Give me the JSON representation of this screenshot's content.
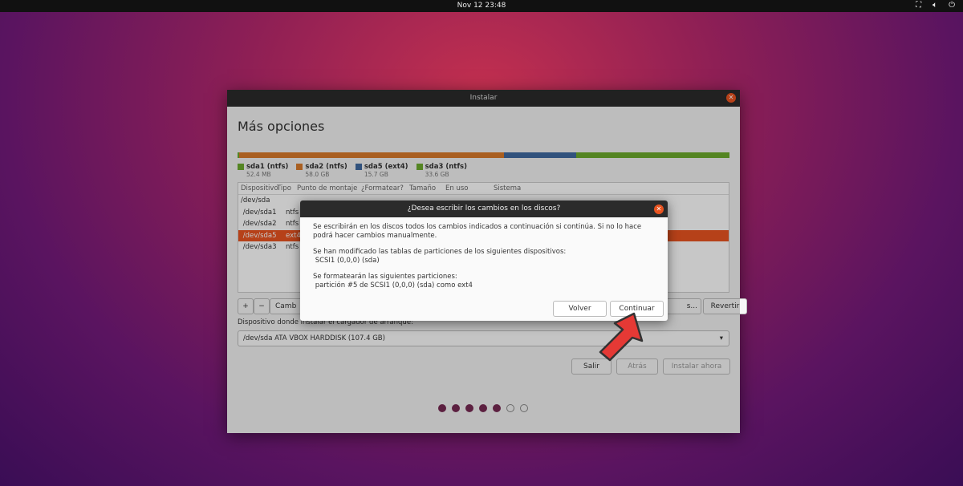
{
  "topbar": {
    "clock": "Nov 12  23:48",
    "icons": [
      "network-icon",
      "volume-icon",
      "power-icon"
    ]
  },
  "window": {
    "title": "Instalar",
    "heading": "Más opciones",
    "partitions": [
      {
        "name": "sda1 (ntfs)",
        "size": "52.4 MB",
        "color": "#6cab2e",
        "gb": 0.05
      },
      {
        "name": "sda2 (ntfs)",
        "size": "58.0 GB",
        "color": "#d97a2b",
        "gb": 58.0
      },
      {
        "name": "sda5 (ext4)",
        "size": "15.7 GB",
        "color": "#3f69a0",
        "gb": 15.7
      },
      {
        "name": "sda3 (ntfs)",
        "size": "33.6 GB",
        "color": "#6cab2e",
        "gb": 33.6
      }
    ],
    "table_headers": [
      "Dispositivo",
      "Tipo",
      "Punto de montaje",
      "¿Formatear?",
      "Tamaño",
      "En uso",
      "Sistema"
    ],
    "rows": [
      {
        "device": "/dev/sda",
        "type": ""
      },
      {
        "device": " /dev/sda1",
        "type": "ntfs"
      },
      {
        "device": " /dev/sda2",
        "type": "ntfs"
      },
      {
        "device": " /dev/sda5",
        "type": "ext4",
        "selected": true
      },
      {
        "device": " /dev/sda3",
        "type": "ntfs"
      }
    ],
    "tools": {
      "add": "+",
      "remove": "−",
      "change": "Camb",
      "new_table": "s...",
      "revert": "Revertir"
    },
    "bootloader_label": "Dispositivo donde instalar el cargador de arranque:",
    "bootloader_value": "/dev/sda    ATA VBOX HARDDISK (107.4 GB)",
    "buttons": {
      "quit": "Salir",
      "back": "Atrás",
      "install": "Instalar ahora"
    },
    "progress": {
      "step": 5,
      "total": 7
    }
  },
  "dialog": {
    "title": "¿Desea escribir los cambios en los discos?",
    "p1": "Se escribirán en los discos todos los cambios indicados a continuación si continúa. Si no lo hace podrá hacer cambios manualmente.",
    "p2a": "Se han modificado las tablas de particiones de los siguientes dispositivos:",
    "p2b": " SCSI1 (0,0,0) (sda)",
    "p3a": "Se formatearán las siguientes particiones:",
    "p3b": " partición #5 de SCSI1 (0,0,0) (sda) como ext4",
    "back": "Volver",
    "continue": "Continuar"
  },
  "colors": {
    "accent": "#e95420",
    "progress": "#772953",
    "arrow": "#e53935"
  }
}
